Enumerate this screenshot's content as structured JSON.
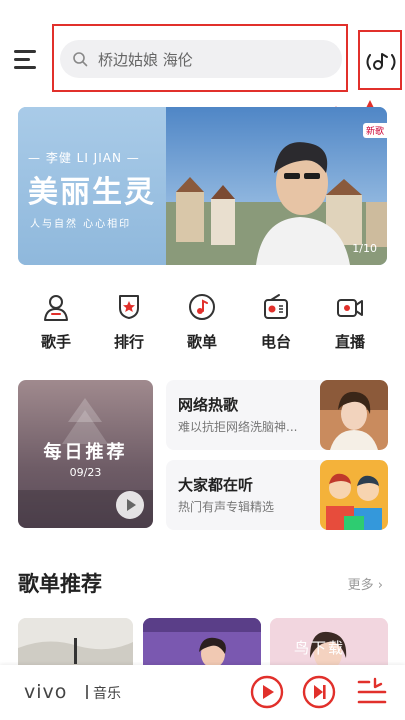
{
  "header": {
    "search_placeholder": "桥边姑娘 海伦"
  },
  "banner": {
    "artist": "— 李健 LI JIAN —",
    "title": "美丽生灵",
    "subtitle": "人与自然  心心相印",
    "badge": "新歌",
    "page_indicator": "1/10"
  },
  "nav": {
    "items": [
      {
        "label": "歌手",
        "icon": "singer-icon"
      },
      {
        "label": "排行",
        "icon": "ranking-icon"
      },
      {
        "label": "歌单",
        "icon": "playlist-icon"
      },
      {
        "label": "电台",
        "icon": "radio-icon"
      },
      {
        "label": "直播",
        "icon": "live-icon"
      }
    ]
  },
  "daily": {
    "title": "每日推荐",
    "date": "09/23"
  },
  "cards": [
    {
      "title": "网络热歌",
      "subtitle": "难以抗拒网络洗脑神..."
    },
    {
      "title": "大家都在听",
      "subtitle": "热门有声专辑精选"
    }
  ],
  "section": {
    "title": "歌单推荐",
    "more": "更多 ›"
  },
  "watermark": "鸟下载",
  "bottom": {
    "brand": "vivo",
    "brand_sub": "音乐"
  },
  "colors": {
    "accent": "#e1302b",
    "highlight_box": "#e1302b"
  }
}
